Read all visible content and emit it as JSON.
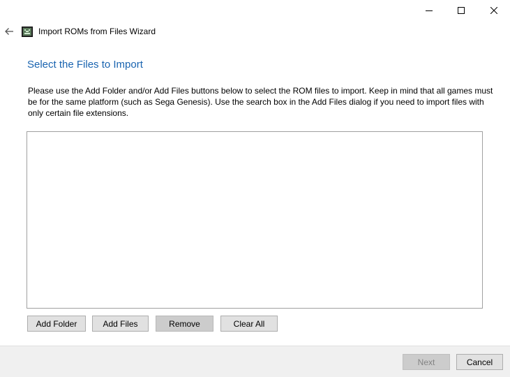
{
  "window": {
    "title": "Import ROMs from Files Wizard",
    "minimize_icon": "minimize-icon",
    "maximize_icon": "maximize-icon",
    "close_icon": "close-icon",
    "back_icon": "arrow-left-icon",
    "app_icon": "emulator-app-icon"
  },
  "page": {
    "heading": "Select the Files to Import",
    "description": "Please use the Add Folder and/or Add Files buttons below to select the ROM files to import. Keep in mind that all games must be for the same platform (such as Sega Genesis). Use the search box in the Add Files dialog if you need to import files with only certain file extensions."
  },
  "file_list": {
    "items": []
  },
  "actions": {
    "add_folder": "Add Folder",
    "add_files": "Add Files",
    "remove": "Remove",
    "clear_all": "Clear All"
  },
  "footer": {
    "next": "Next",
    "cancel": "Cancel"
  },
  "colors": {
    "heading": "#1a64b0",
    "footer_bg": "#f0f0f0",
    "button_bg": "#e1e1e1"
  }
}
